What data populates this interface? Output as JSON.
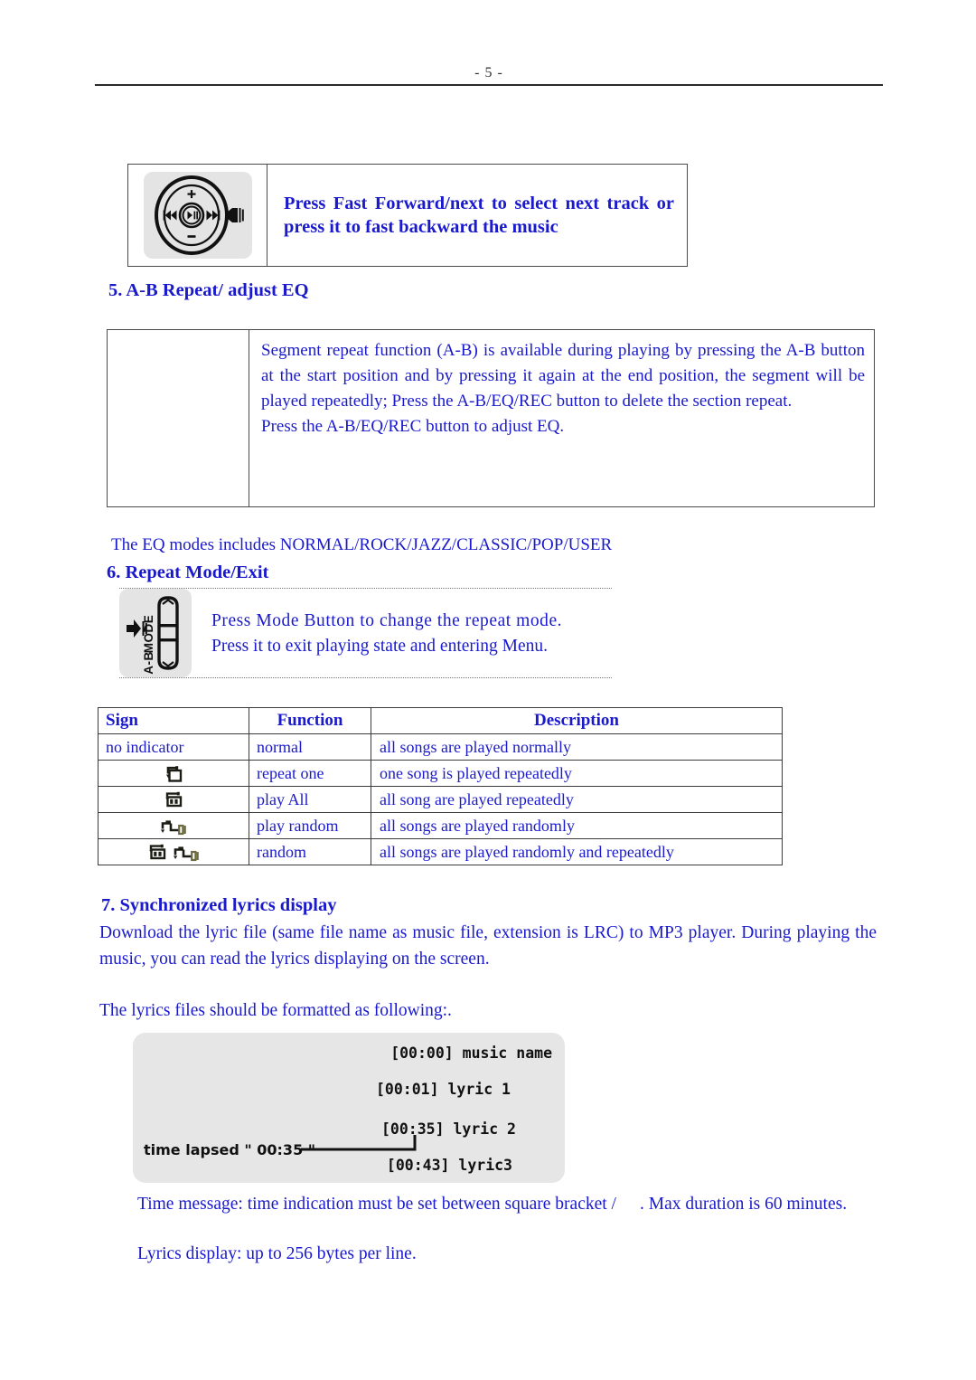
{
  "page": {
    "number_label": "- 5 -",
    "text_color": "#1a1acc",
    "rule_color": "#2a2a2a"
  },
  "figure_top": {
    "icon_name": "player-control-wheel-icon",
    "callout_line1": "Press Fast Forward/next to select next track or",
    "callout_line2": "press it to fast backward the music"
  },
  "section5": {
    "heading": "5. A-B Repeat/ adjust EQ",
    "paragraph1": "Segment repeat function (A-B) is available during playing by pressing the A-B button at the start position and by pressing it again at the end position, the segment will be played repeatedly; Press the A-B/EQ/REC button to delete the section repeat.",
    "paragraph2": "Press the A-B/EQ/REC button to adjust EQ.",
    "eq_modes_line": "The EQ modes includes NORMAL/ROCK/JAZZ/CLASSIC/POP/USER"
  },
  "section6": {
    "heading": "6. Repeat Mode/Exit",
    "icon_name": "ab-mode-side-button-icon",
    "icon_label_top": "MODE",
    "icon_label_bottom": "A-B",
    "text_line1": "Press Mode Button to change the repeat mode.",
    "text_line2": "Press it to exit playing state and entering Menu."
  },
  "mode_table": {
    "headers": [
      "Sign",
      "Function",
      "Description"
    ],
    "rows": [
      {
        "sign_text": "no indicator",
        "sign_icon": "none",
        "function": "normal",
        "description": "all songs are played normally"
      },
      {
        "sign_text": "",
        "sign_icon": "repeat-one-icon",
        "function": "repeat one",
        "description": "one song is played repeatedly"
      },
      {
        "sign_text": "",
        "sign_icon": "repeat-all-icon",
        "function": "play All",
        "description": "all song are played repeatedly"
      },
      {
        "sign_text": "",
        "sign_icon": "shuffle-icon",
        "function": "play random",
        "description": "all songs are played randomly"
      },
      {
        "sign_text": "",
        "sign_icon": "repeat-all-shuffle-icon",
        "function": "random",
        "description": "all songs are played randomly and repeatedly"
      }
    ]
  },
  "section7": {
    "heading": "7. Synchronized lyrics display",
    "paragraph1": "Download the lyric file (same file name as music file, extension is LRC) to MP3 player. During playing the music, you can read the lyrics displaying on the screen.",
    "paragraph2": "The lyrics files should be formatted as following:.",
    "lyrics_figure": {
      "background": "#e6e6e6",
      "lines": [
        "[00:00] music name",
        "[00:01] lyric 1",
        "[00:35] lyric 2",
        "[00:43] lyric3"
      ],
      "annotation": "time lapsed \" 00:35 \""
    },
    "note1_part1": "Time message: time indication must be set between square bracket /",
    "note1_part2": ". Max duration is 60 minutes.",
    "note2": "Lyrics display: up to 256 bytes per line."
  }
}
